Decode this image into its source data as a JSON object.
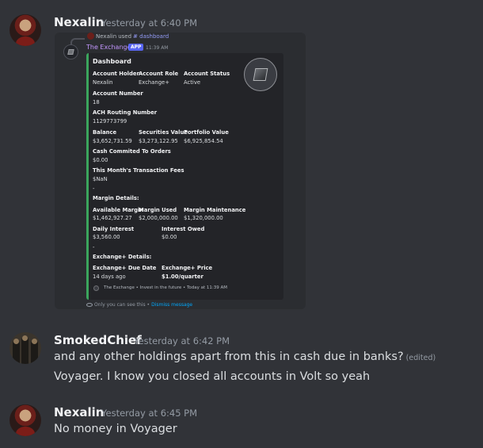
{
  "messages": [
    {
      "author": "Nexalin",
      "timestamp": "Yesterday at 6:40 PM"
    },
    {
      "author": "SmokedChief",
      "timestamp": "Yesterday at 6:42 PM",
      "lines": [
        "and any other holdings apart from this in cash due in banks?",
        "Voyager. I know you closed all accounts in Volt so yeah"
      ],
      "edited": "(edited)"
    },
    {
      "author": "Nexalin",
      "timestamp": "Yesterday at 6:45 PM",
      "lines": [
        "No money in Voyager"
      ]
    }
  ],
  "command_ref": {
    "user": "Nexalin",
    "used": "used",
    "command": "# dashboard"
  },
  "bot": {
    "name": "The Exchange",
    "tag": "APP",
    "time": "11:39 AM"
  },
  "embed": {
    "title": "Dashboard",
    "color": "#3ba55d",
    "account_holder": {
      "label": "Account Holder",
      "value": "Nexalin"
    },
    "account_role": {
      "label": "Account Role",
      "value": "Exchange+"
    },
    "account_status": {
      "label": "Account Status",
      "value": "Active"
    },
    "account_number": {
      "label": "Account Number",
      "value": "18"
    },
    "ach_routing": {
      "label": "ACH Routing Number",
      "value": "1129773799"
    },
    "balance": {
      "label": "Balance",
      "value": "$3,652,731.59"
    },
    "securities": {
      "label": "Securities Value",
      "value": "$3,273,122.95"
    },
    "portfolio": {
      "label": "Portfolio Value",
      "value": "$6,925,854.54"
    },
    "cash_committed": {
      "label": "Cash Commited To Orders",
      "value": "$0.00"
    },
    "tx_fees": {
      "label": "This Month's Transaction Fees",
      "value": "$NaN"
    },
    "divider": "-",
    "margin_header": "Margin Details:",
    "available_margin": {
      "label": "Available Margin",
      "value": "$1,462,927.27"
    },
    "margin_used": {
      "label": "Margin Used",
      "value": "$2,000,000.00"
    },
    "margin_maintenance": {
      "label": "Margin Maintenance",
      "value": "$1,320,000.00"
    },
    "daily_interest": {
      "label": "Daily Interest",
      "value": "$3,560.00"
    },
    "interest_owed": {
      "label": "Interest Owed",
      "value": "$0.00"
    },
    "exchange_header": "Exchange+ Details:",
    "due_date": {
      "label": "Exchange+ Due Date",
      "value": "14 days ago"
    },
    "price": {
      "label": "Exchange+ Price",
      "value": "$1.00/quarter"
    },
    "footer": "The Exchange • Invest in the future • Today at 11:39 AM"
  },
  "ephemeral": {
    "text": "Only you can see this •",
    "dismiss": "Dismiss message"
  }
}
